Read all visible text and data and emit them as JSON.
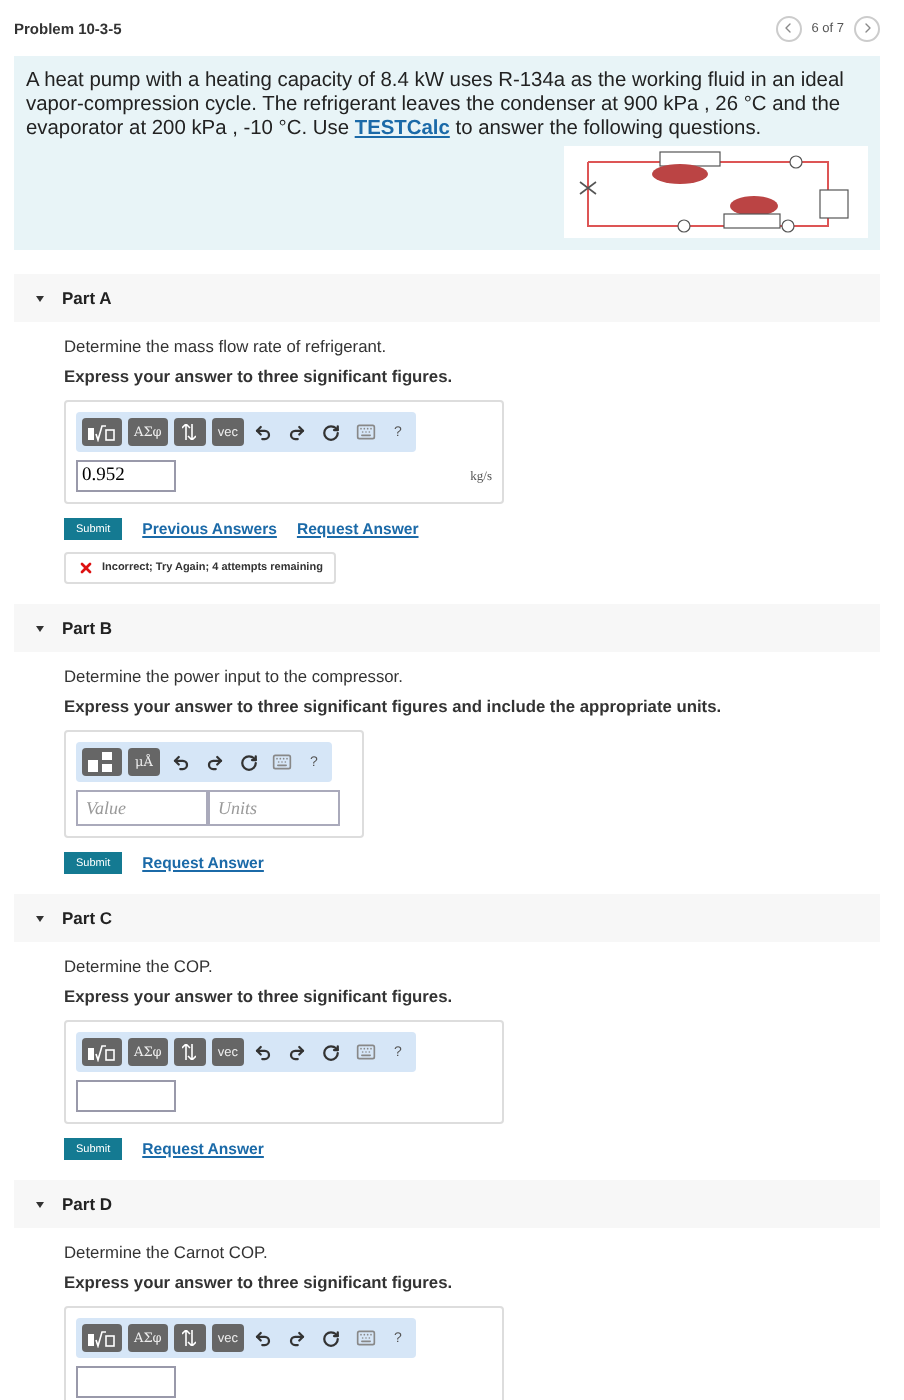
{
  "header": {
    "title": "Problem 10-3-5",
    "pager": "6 of 7"
  },
  "intro": {
    "text_before": "A heat pump with a heating capacity of 8.4 kW uses R-134a as the working fluid in an ideal vapor-compression cycle. The refrigerant leaves the condenser at 900 kPa , 26 °C and the evaporator at 200 kPa , -10 °C. Use ",
    "link": "TESTCalc",
    "text_after": " to answer the following questions."
  },
  "parts": [
    {
      "title": "Part A",
      "expanded": true,
      "question": "Determine the mass flow rate of refrigerant.",
      "instruction": "Express your answer to three significant figures.",
      "toolbar": {
        "kind": "scalar",
        "symbols": "ΑΣφ",
        "vec": "vec",
        "help": "?"
      },
      "answer": {
        "kind": "scalar",
        "value": "0.952",
        "unit": "kg/s"
      },
      "links": [
        "Previous Answers",
        "Request Answer"
      ],
      "submit": "Submit",
      "feedback": {
        "kind": "incorrect",
        "text": "Incorrect; Try Again; 4 attempts remaining"
      }
    },
    {
      "title": "Part B",
      "expanded": true,
      "question": "Determine the power input to the compressor.",
      "instruction": "Express your answer to three significant figures and include the appropriate units.",
      "toolbar": {
        "kind": "units",
        "symbols": "μÅ",
        "help": "?"
      },
      "answer": {
        "kind": "units",
        "value_placeholder": "Value",
        "units_placeholder": "Units"
      },
      "links": [
        "Request Answer"
      ],
      "submit": "Submit"
    },
    {
      "title": "Part C",
      "expanded": true,
      "question": "Determine the COP.",
      "instruction": "Express your answer to three significant figures.",
      "toolbar": {
        "kind": "scalar",
        "symbols": "ΑΣφ",
        "vec": "vec",
        "help": "?"
      },
      "answer": {
        "kind": "scalar"
      },
      "links": [
        "Request Answer"
      ],
      "submit": "Submit"
    },
    {
      "title": "Part D",
      "expanded": true,
      "question": "Determine the Carnot COP.",
      "instruction": "Express your answer to three significant figures.",
      "toolbar": {
        "kind": "scalar",
        "symbols": "ΑΣφ",
        "vec": "vec",
        "help": "?"
      },
      "answer": {
        "kind": "scalar"
      }
    }
  ]
}
